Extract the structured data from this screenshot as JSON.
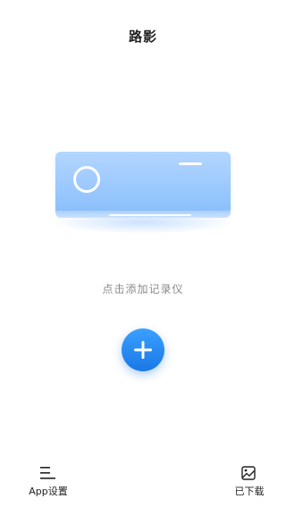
{
  "header": {
    "title": "路影"
  },
  "device": {
    "illustration": "air-conditioner",
    "color": "#9cc8fd"
  },
  "empty_state": {
    "hint": "点击添加记录仪"
  },
  "add_button": {
    "icon": "plus-icon",
    "color": "#2a8cf5"
  },
  "tabbar": {
    "items": [
      {
        "label": "App设置",
        "icon": "menu-lines-icon"
      },
      {
        "label": "已下载",
        "icon": "image-download-icon"
      }
    ]
  }
}
